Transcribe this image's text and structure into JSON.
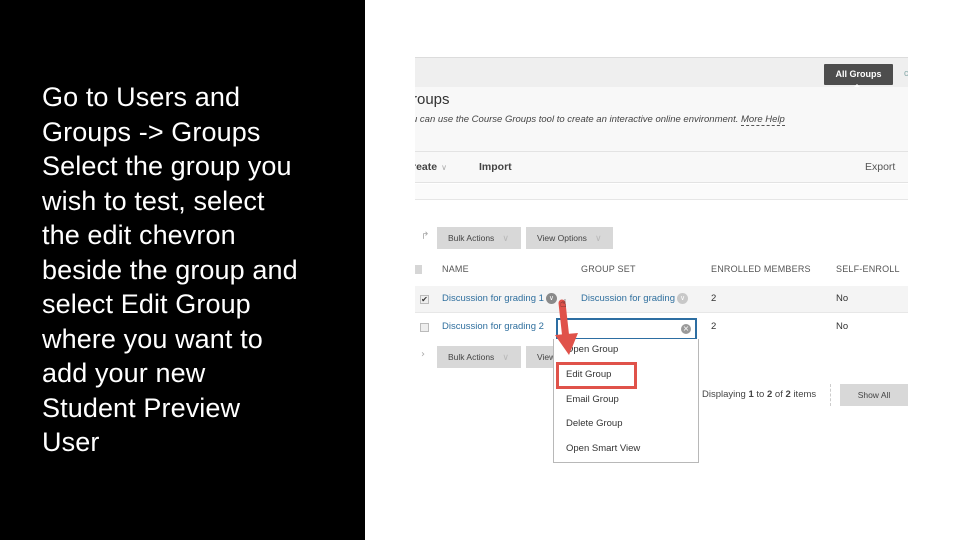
{
  "instructions": {
    "lines": [
      "Go to Users and",
      "Groups -> Groups",
      "Select the group you",
      "wish to test, select",
      "the edit chevron",
      "beside the group and",
      "select Edit Group",
      "where you want to",
      "add your new",
      "Student Preview",
      "User"
    ]
  },
  "screenshot": {
    "top_button": "All Groups",
    "title": "roups",
    "description": "u can use the Course Groups tool to create an interactive online environment.",
    "more_help": "More Help",
    "action_bar": {
      "create": "reate",
      "import": "Import",
      "export": "Export"
    },
    "bulk_actions": "Bulk Actions",
    "view_options": "View Options",
    "view_partial": "View",
    "columns": [
      "NAME",
      "GROUP SET",
      "ENROLLED MEMBERS",
      "SELF-ENROLL"
    ],
    "rows": [
      {
        "name": "Discussion for grading 1",
        "group_set": "Discussion for grading",
        "enrolled": "2",
        "self_enroll": "No",
        "checked": true
      },
      {
        "name": "Discussion for grading 2",
        "group_set": "",
        "enrolled": "2",
        "self_enroll": "No",
        "checked": false
      }
    ],
    "menu": {
      "items": [
        "Open Group",
        "Edit Group",
        "Email Group",
        "Delete Group",
        "Open Smart View"
      ],
      "highlighted": "Edit Group"
    },
    "paging": {
      "prefix": "Displaying",
      "from": "1",
      "to_word": "to",
      "to": "2",
      "of_word": "of",
      "total": "2",
      "suffix": "items"
    },
    "show_all": "Show All",
    "colors": {
      "annotation": "#e0524a",
      "link": "#2f6f9e",
      "focus": "#2d6ea2"
    }
  }
}
